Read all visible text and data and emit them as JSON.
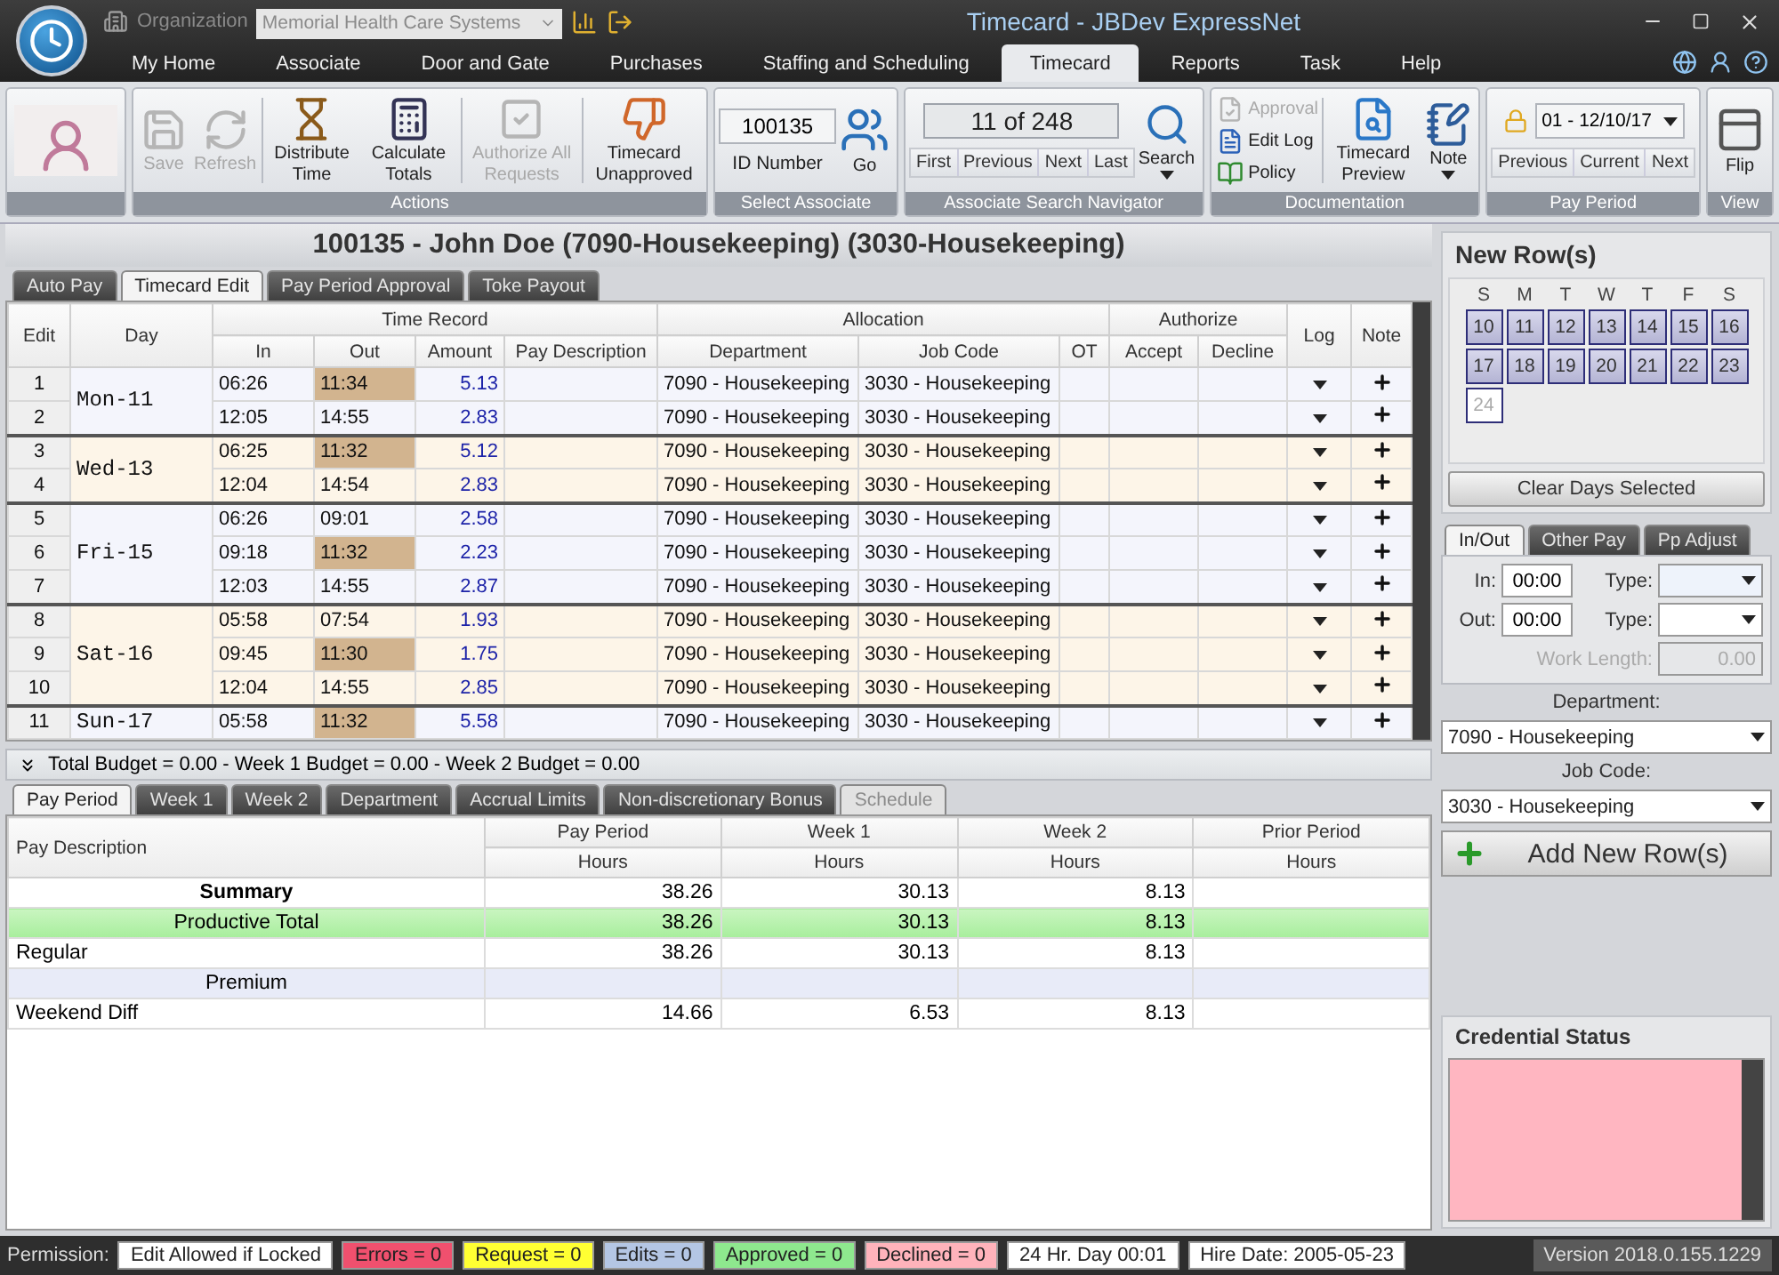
{
  "window": {
    "title": "Timecard - JBDev ExpressNet"
  },
  "organization": {
    "label": "Organization",
    "value": "Memorial Health Care Systems"
  },
  "menu_tabs": [
    {
      "label": "My Home",
      "selected": false
    },
    {
      "label": "Associate",
      "selected": false
    },
    {
      "label": "Door and Gate",
      "selected": false
    },
    {
      "label": "Purchases",
      "selected": false
    },
    {
      "label": "Staffing and Scheduling",
      "selected": false
    },
    {
      "label": "Timecard",
      "selected": true
    },
    {
      "label": "Reports",
      "selected": false
    },
    {
      "label": "Task",
      "selected": false
    },
    {
      "label": "Help",
      "selected": false
    }
  ],
  "ribbon": {
    "actions": {
      "title": "Actions",
      "buttons": [
        {
          "label": "Save",
          "kind": "save",
          "disabled": true
        },
        {
          "label": "Refresh",
          "kind": "refresh",
          "disabled": true
        },
        {
          "label": "Distribute Time",
          "kind": "distribute",
          "disabled": false
        },
        {
          "label": "Calculate Totals",
          "kind": "calculate",
          "disabled": false
        },
        {
          "label": "Authorize All Requests",
          "kind": "authorize",
          "disabled": true
        },
        {
          "label": "Timecard Unapproved",
          "kind": "unapprove",
          "disabled": false
        }
      ]
    },
    "select_associate": {
      "title": "Select Associate",
      "id_number": "100135",
      "caption": "ID Number",
      "go": "Go"
    },
    "navigator": {
      "title": "Associate Search Navigator",
      "counter": "11 of 248",
      "buttons": [
        "First",
        "Previous",
        "Next",
        "Last"
      ],
      "search": "Search"
    },
    "documentation": {
      "title": "Documentation",
      "links": [
        {
          "label": "Approval",
          "kind": "approval",
          "disabled": true
        },
        {
          "label": "Edit Log",
          "kind": "log",
          "disabled": false
        },
        {
          "label": "Policy",
          "kind": "policy",
          "disabled": false
        }
      ],
      "buttons": [
        {
          "label": "Timecard Preview",
          "kind": "preview"
        },
        {
          "label": "Note",
          "kind": "note"
        }
      ]
    },
    "pay_period": {
      "title": "Pay Period",
      "value": "01 - 12/10/17",
      "buttons": [
        "Previous",
        "Current",
        "Next"
      ]
    },
    "view": {
      "title": "View",
      "button": "Flip"
    }
  },
  "employee_title": "100135 - John Doe (7090-Housekeeping)  (3030-Housekeeping)",
  "sub_tabs": [
    {
      "label": "Auto Pay",
      "selected": false
    },
    {
      "label": "Timecard Edit",
      "selected": true
    },
    {
      "label": "Pay Period Approval",
      "selected": false
    },
    {
      "label": "Toke Payout",
      "selected": false
    }
  ],
  "grid": {
    "columns": [
      {
        "kind": "single",
        "label": "Edit"
      },
      {
        "kind": "single",
        "label": "Day"
      },
      {
        "kind": "group",
        "label": "Time Record",
        "columns": [
          "In",
          "Out",
          "Amount",
          "Pay Description"
        ]
      },
      {
        "kind": "group",
        "label": "Allocation",
        "columns": [
          "Department",
          "Job Code",
          "OT"
        ]
      },
      {
        "kind": "group",
        "label": "Authorize",
        "columns": [
          "Accept",
          "Decline"
        ]
      },
      {
        "kind": "single",
        "label": "Log"
      },
      {
        "kind": "single",
        "label": "Note"
      }
    ],
    "days": [
      {
        "day": "Mon-11",
        "warm": false,
        "rows": [
          {
            "edit": "1",
            "in": "06:26",
            "out": "11:34",
            "flagged": true,
            "amount": "5.13",
            "department": "7090 - Housekeeping",
            "job_code": "3030 - Housekeeping"
          },
          {
            "edit": "2",
            "in": "12:05",
            "out": "14:55",
            "flagged": false,
            "amount": "2.83",
            "department": "7090 - Housekeeping",
            "job_code": "3030 - Housekeeping"
          }
        ]
      },
      {
        "day": "Wed-13",
        "warm": true,
        "rows": [
          {
            "edit": "3",
            "in": "06:25",
            "out": "11:32",
            "flagged": true,
            "amount": "5.12",
            "department": "7090 - Housekeeping",
            "job_code": "3030 - Housekeeping"
          },
          {
            "edit": "4",
            "in": "12:04",
            "out": "14:54",
            "flagged": false,
            "amount": "2.83",
            "department": "7090 - Housekeeping",
            "job_code": "3030 - Housekeeping"
          }
        ]
      },
      {
        "day": "Fri-15",
        "warm": false,
        "rows": [
          {
            "edit": "5",
            "in": "06:26",
            "out": "09:01",
            "flagged": false,
            "amount": "2.58",
            "department": "7090 - Housekeeping",
            "job_code": "3030 - Housekeeping"
          },
          {
            "edit": "6",
            "in": "09:18",
            "out": "11:32",
            "flagged": true,
            "amount": "2.23",
            "department": "7090 - Housekeeping",
            "job_code": "3030 - Housekeeping"
          },
          {
            "edit": "7",
            "in": "12:03",
            "out": "14:55",
            "flagged": false,
            "amount": "2.87",
            "department": "7090 - Housekeeping",
            "job_code": "3030 - Housekeeping"
          }
        ]
      },
      {
        "day": "Sat-16",
        "warm": true,
        "rows": [
          {
            "edit": "8",
            "in": "05:58",
            "out": "07:54",
            "flagged": false,
            "amount": "1.93",
            "department": "7090 - Housekeeping",
            "job_code": "3030 - Housekeeping"
          },
          {
            "edit": "9",
            "in": "09:45",
            "out": "11:30",
            "flagged": true,
            "amount": "1.75",
            "department": "7090 - Housekeeping",
            "job_code": "3030 - Housekeeping"
          },
          {
            "edit": "10",
            "in": "12:04",
            "out": "14:55",
            "flagged": false,
            "amount": "2.85",
            "department": "7090 - Housekeeping",
            "job_code": "3030 - Housekeeping"
          }
        ]
      },
      {
        "day": "Sun-17",
        "warm": false,
        "rows": [
          {
            "edit": "11",
            "in": "05:58",
            "out": "11:32",
            "flagged": true,
            "amount": "5.58",
            "department": "7090 - Housekeeping",
            "job_code": "3030 - Housekeeping"
          }
        ]
      }
    ]
  },
  "budget": "Total Budget = 0.00 - Week 1 Budget = 0.00 - Week 2 Budget = 0.00",
  "bottom_tabs": [
    {
      "label": "Pay Period",
      "selected": true,
      "disabled": false
    },
    {
      "label": "Week 1",
      "selected": false,
      "disabled": false
    },
    {
      "label": "Week 2",
      "selected": false,
      "disabled": false
    },
    {
      "label": "Department",
      "selected": false,
      "disabled": false
    },
    {
      "label": "Accrual Limits",
      "selected": false,
      "disabled": false
    },
    {
      "label": "Non-discretionary Bonus",
      "selected": false,
      "disabled": false
    },
    {
      "label": "Schedule",
      "selected": false,
      "disabled": true
    }
  ],
  "hours_table": {
    "first_column": "Pay Description",
    "columns": [
      {
        "label": "Pay Period",
        "unit": "Hours"
      },
      {
        "label": "Week 1",
        "unit": "Hours"
      },
      {
        "label": "Week 2",
        "unit": "Hours"
      },
      {
        "label": "Prior Period",
        "unit": "Hours"
      }
    ],
    "rows": [
      {
        "label": "Summary",
        "kind": "summary",
        "pay_period": "38.26",
        "week_1": "30.13",
        "week_2": "8.13"
      },
      {
        "label": "Productive Total",
        "kind": "total",
        "pay_period": "38.26",
        "week_1": "30.13",
        "week_2": "8.13"
      },
      {
        "label": "Regular",
        "kind": "item",
        "pay_period": "38.26",
        "week_1": "30.13",
        "week_2": "8.13"
      },
      {
        "label": "Premium",
        "kind": "group"
      },
      {
        "label": "Weekend Diff",
        "kind": "item",
        "pay_period": "14.66",
        "week_1": "6.53",
        "week_2": "8.13"
      }
    ]
  },
  "new_rows": {
    "title": "New Row(s)",
    "weekdays": [
      "S",
      "M",
      "T",
      "W",
      "T",
      "F",
      "S"
    ],
    "days": [
      {
        "label": "10",
        "selected": true
      },
      {
        "label": "11",
        "selected": true
      },
      {
        "label": "12",
        "selected": true
      },
      {
        "label": "13",
        "selected": true
      },
      {
        "label": "14",
        "selected": true
      },
      {
        "label": "15",
        "selected": true
      },
      {
        "label": "16",
        "selected": true
      },
      {
        "label": "17",
        "selected": true
      },
      {
        "label": "18",
        "selected": true
      },
      {
        "label": "19",
        "selected": true
      },
      {
        "label": "20",
        "selected": true
      },
      {
        "label": "21",
        "selected": true
      },
      {
        "label": "22",
        "selected": true
      },
      {
        "label": "23",
        "selected": true
      },
      {
        "label": "24",
        "selected": false
      }
    ],
    "clear_button": "Clear Days Selected",
    "tabs": [
      {
        "label": "In/Out",
        "selected": true
      },
      {
        "label": "Other Pay",
        "selected": false
      },
      {
        "label": "Pp Adjust",
        "selected": false
      }
    ],
    "in_label": "In:",
    "in_value": "00:00",
    "out_label": "Out:",
    "out_value": "00:00",
    "type_label": "Type:",
    "type_label_2": "Type:",
    "work_length_label": "Work Length:",
    "work_length_value": "0.00",
    "department_label": "Department:",
    "department_value": "7090 - Housekeeping",
    "job_code_label": "Job Code:",
    "job_code_value": "3030 - Housekeeping",
    "add_button": "Add New Row(s)"
  },
  "credential_status": {
    "title": "Credential Status"
  },
  "status_bar": {
    "permission_label": "Permission:",
    "permission_value": "Edit Allowed if Locked",
    "badges": [
      {
        "label": "Errors = 0",
        "color": "#f0506e"
      },
      {
        "label": "Request = 0",
        "color": "#ffff33"
      },
      {
        "label": "Edits = 0",
        "color": "#b4c6e4"
      },
      {
        "label": "Approved = 0",
        "color": "#8ee88e"
      },
      {
        "label": "Declined = 0",
        "color": "#ffb3bb"
      },
      {
        "label": "24 Hr. Day 00:01",
        "color": "#ffffff"
      },
      {
        "label": "Hire Date: 2005-05-23",
        "color": "#ffffff"
      }
    ],
    "version": "Version 2018.0.155.1229"
  }
}
